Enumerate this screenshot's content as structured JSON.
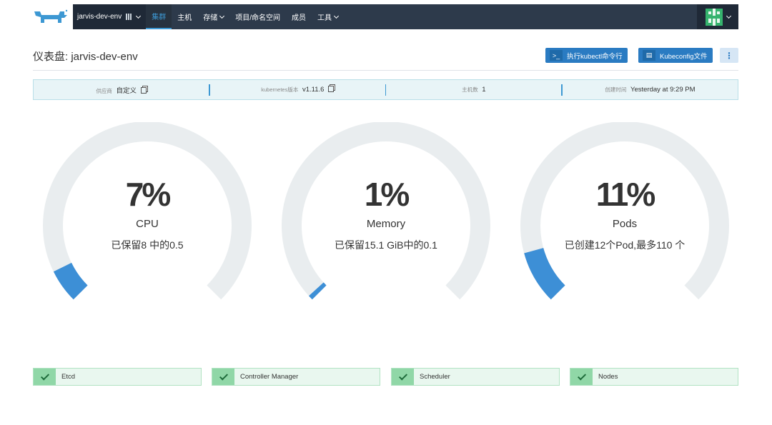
{
  "nav": {
    "cluster_name": "jarvis-dev-env",
    "items": [
      {
        "label": "集群",
        "dropdown": false,
        "active": true
      },
      {
        "label": "主机",
        "dropdown": false,
        "active": false
      },
      {
        "label": "存储",
        "dropdown": true,
        "active": false
      },
      {
        "label": "项目/命名空间",
        "dropdown": false,
        "active": false
      },
      {
        "label": "成员",
        "dropdown": false,
        "active": false
      },
      {
        "label": "工具",
        "dropdown": true,
        "active": false
      }
    ]
  },
  "header": {
    "title": "仪表盘: jarvis-dev-env",
    "kubectl_button": "执行kubectl命令行",
    "kubeconfig_button": "Kubeconfig文件",
    "more_button": "⋮"
  },
  "info": {
    "provider_label": "供应商",
    "provider_value": "自定义",
    "k8s_label": "kubernetes版本",
    "k8s_value": "v1.11.6",
    "hosts_label": "主机数",
    "hosts_value": "1",
    "created_label": "创建时间",
    "created_value": "Yesterday at 9:29 PM"
  },
  "gauges": [
    {
      "percent_text": "7%",
      "percent": 7,
      "name": "CPU",
      "detail": "已保留8 中的0.5"
    },
    {
      "percent_text": "1%",
      "percent": 1,
      "name": "Memory",
      "detail": "已保留15.1 GiB中的0.1"
    },
    {
      "percent_text": "11%",
      "percent": 11,
      "name": "Pods",
      "detail": "已创建12个Pod,最多110 个"
    }
  ],
  "health": [
    {
      "label": "Etcd"
    },
    {
      "label": "Controller Manager"
    },
    {
      "label": "Scheduler"
    },
    {
      "label": "Nodes"
    }
  ],
  "colors": {
    "nav_bg": "#2d3a4b",
    "accent": "#3d98d3",
    "button": "#2a7bc2",
    "gauge_track": "#e9edef",
    "gauge_fill": "#3d8fd6",
    "health_ok": "#90d7a7"
  }
}
